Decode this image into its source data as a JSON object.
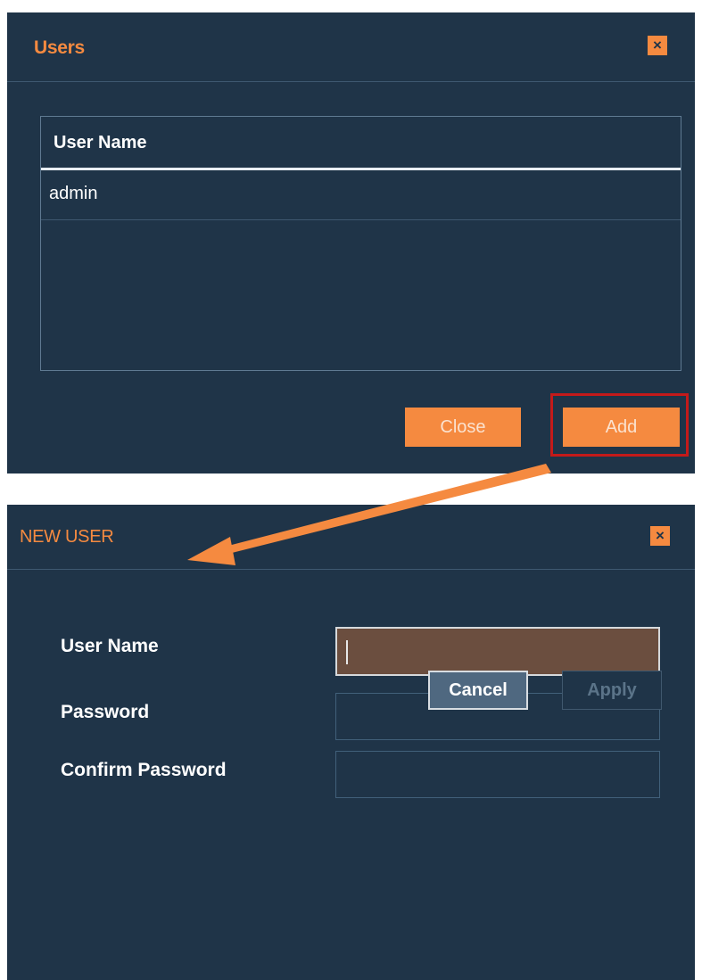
{
  "users_dialog": {
    "title": "Users",
    "close_icon": "×",
    "table": {
      "column_header": "User Name",
      "rows": [
        "admin"
      ]
    },
    "buttons": {
      "close": "Close",
      "add": "Add"
    }
  },
  "new_user_dialog": {
    "title": "NEW USER",
    "close_icon": "×",
    "fields": {
      "username_label": "User Name",
      "password_label": "Password",
      "confirm_label": "Confirm Password"
    },
    "buttons": {
      "cancel": "Cancel",
      "apply": "Apply"
    }
  },
  "colors": {
    "dialog_bg": "#1f3448",
    "accent": "#f58a40",
    "highlight": "#c41a1a",
    "active_field": "#6b4e3f"
  }
}
